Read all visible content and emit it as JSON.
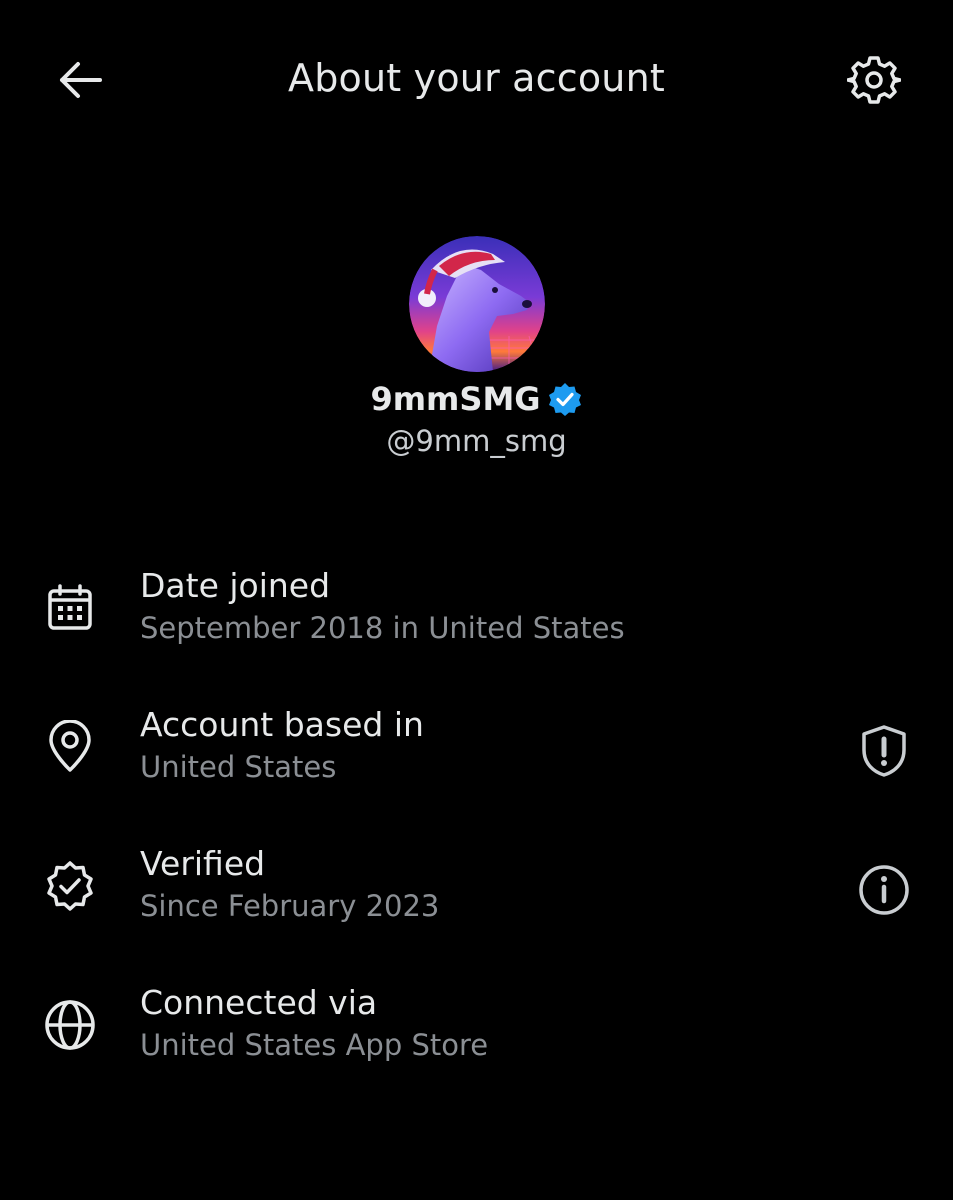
{
  "header": {
    "title": "About your account",
    "back_icon": "arrow-left-icon",
    "settings_icon": "gear-icon"
  },
  "profile": {
    "display_name": "9mmSMG",
    "handle": "@9mm_smg",
    "verified_badge_icon": "verified-badge-icon",
    "verified_color": "#1d9bf0"
  },
  "info_items": [
    {
      "icon": "calendar-icon",
      "title": "Date joined",
      "subtitle": "September 2018 in United States"
    },
    {
      "icon": "location-pin-icon",
      "title": "Account based in",
      "subtitle": "United States",
      "action_icon": "shield-alert-icon"
    },
    {
      "icon": "verified-seal-icon",
      "title": "Verified",
      "subtitle": "Since February 2023",
      "action_icon": "info-icon"
    },
    {
      "icon": "globe-icon",
      "title": "Connected via",
      "subtitle": "United States App Store"
    }
  ],
  "colors": {
    "background": "#000000",
    "primary_text": "#e7e9ea",
    "secondary_text": "#8b8f94",
    "accent_blue": "#1d9bf0"
  }
}
